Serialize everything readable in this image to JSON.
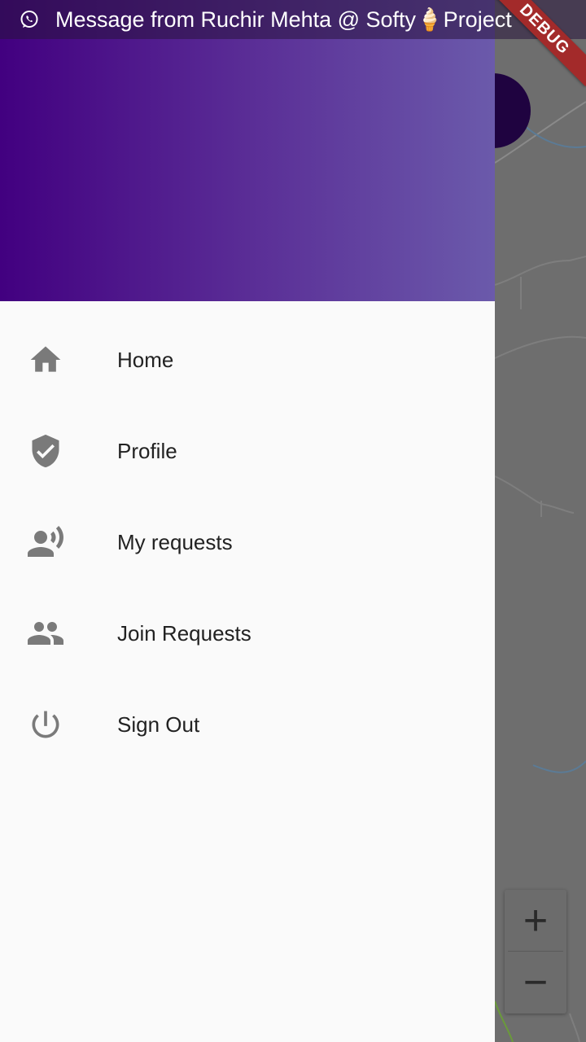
{
  "status_bar": {
    "notification_text": "Message from Ruchir Mehta @ Softy🍦Project",
    "icon": "whatsapp-icon"
  },
  "debug_banner": {
    "label": "DEBUG",
    "color": "#a32a2a"
  },
  "drawer": {
    "header_gradient": [
      "#420080",
      "#6b5aab"
    ],
    "items": [
      {
        "label": "Home",
        "icon": "home-icon"
      },
      {
        "label": "Profile",
        "icon": "shield-check-icon"
      },
      {
        "label": "My requests",
        "icon": "record-voice-icon"
      },
      {
        "label": "Join Requests",
        "icon": "people-icon"
      },
      {
        "label": "Sign Out",
        "icon": "power-icon"
      }
    ]
  },
  "map": {
    "zoom_in_label": "+",
    "zoom_out_label": "−"
  }
}
